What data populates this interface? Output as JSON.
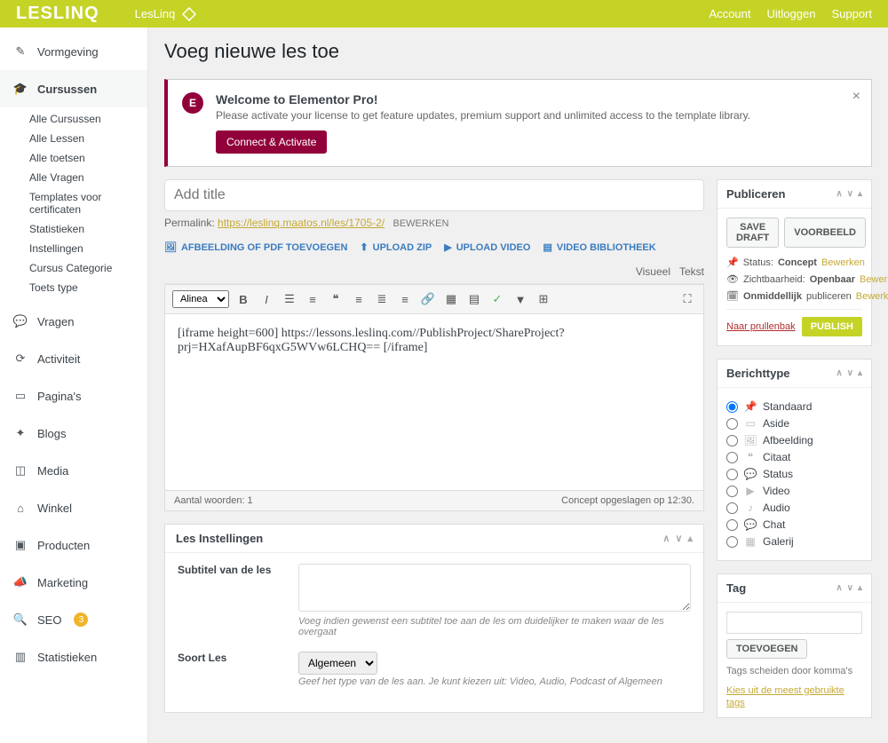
{
  "topbar": {
    "logo": "LESLINQ",
    "brand": "LesLinq",
    "links": [
      "Account",
      "Uitloggen",
      "Support"
    ]
  },
  "sidebar": {
    "items": [
      {
        "label": "Vormgeving"
      },
      {
        "label": "Cursussen",
        "current": true,
        "sub": [
          "Alle Cursussen",
          "Alle Lessen",
          "Alle toetsen",
          "Alle Vragen",
          "Templates voor certificaten",
          "Statistieken",
          "Instellingen",
          "Cursus Categorie",
          "Toets type"
        ]
      },
      {
        "label": "Vragen"
      },
      {
        "label": "Activiteit"
      },
      {
        "label": "Pagina's"
      },
      {
        "label": "Blogs"
      },
      {
        "label": "Media"
      },
      {
        "label": "Winkel"
      },
      {
        "label": "Producten"
      },
      {
        "label": "Marketing"
      },
      {
        "label": "SEO",
        "badge": "3"
      },
      {
        "label": "Statistieken"
      }
    ]
  },
  "page_title": "Voeg nieuwe les toe",
  "notice": {
    "title": "Welcome to Elementor Pro!",
    "body": "Please activate your license to get feature updates, premium support and unlimited access to the template library.",
    "button": "Connect & Activate"
  },
  "title_placeholder": "Add title",
  "permalink": {
    "label": "Permalink:",
    "url": "https://leslinq.maatos.nl/les/1705-2/",
    "edit": "BEWERKEN"
  },
  "media": [
    "AFBEELDING OF PDF TOEVOEGEN",
    "UPLOAD ZIP",
    "UPLOAD VIDEO",
    "VIDEO BIBLIOTHEEK"
  ],
  "tabs": [
    "Visueel",
    "Tekst"
  ],
  "format_select": "Alinea",
  "editor_content": "[iframe height=600] https://lessons.leslinq.com//PublishProject/ShareProject?prj=HXafAupBF6qxG5WVw6LCHQ== [/iframe]",
  "wordcount": "Aantal woorden: 1",
  "draft_status": "Concept opgeslagen op 12:30.",
  "lesson_settings": {
    "title": "Les Instellingen",
    "subtitle_label": "Subtitel van de les",
    "subtitle_desc": "Voeg indien gewenst een subtitel toe aan de les om duidelijker te maken waar de les overgaat",
    "type_label": "Soort Les",
    "type_value": "Algemeen",
    "type_desc": "Geef het type van de les aan. Je kunt kiezen uit: Video, Audio, Podcast of Algemeen"
  },
  "publish": {
    "title": "Publiceren",
    "save_draft": "SAVE DRAFT",
    "preview": "VOORBEELD",
    "status_lbl": "Status:",
    "status_val": "Concept",
    "edit": "Bewerken",
    "vis_lbl": "Zichtbaarheid:",
    "vis_val": "Openbaar",
    "sched_lbl": "Onmiddellijk",
    "sched_tail": "publiceren",
    "trash": "Naar prullenbak",
    "publish_btn": "PUBLISH"
  },
  "format": {
    "title": "Berichttype",
    "options": [
      "Standaard",
      "Aside",
      "Afbeelding",
      "Citaat",
      "Status",
      "Video",
      "Audio",
      "Chat",
      "Galerij"
    ]
  },
  "tags": {
    "title": "Tag",
    "add": "TOEVOEGEN",
    "hint": "Tags scheiden door komma's",
    "choose": "Kies uit de meest gebruikte tags"
  }
}
